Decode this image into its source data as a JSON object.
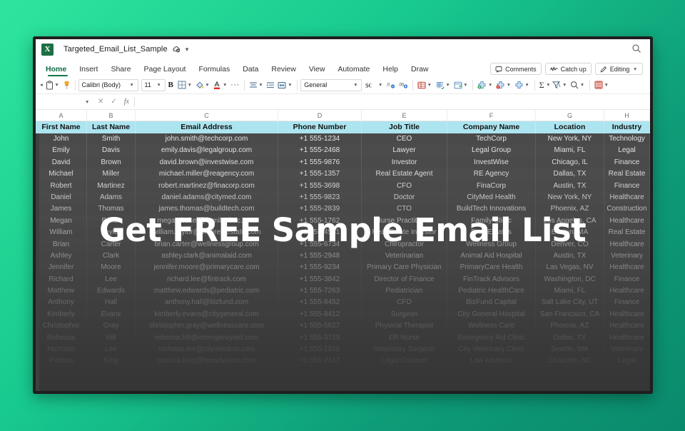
{
  "theme": {
    "background_gradient_from": "#2ee59d",
    "background_gradient_to": "#0a8a6c",
    "accent": "#11794c",
    "header_row_fill": "#ace4ef",
    "overlay_text_color": "#ffffff"
  },
  "overlay": {
    "headline": "Get FREE Sample Email List"
  },
  "titlebar": {
    "app_icon": "excel-icon",
    "app_icon_letter": "X",
    "document_name": "Targeted_Email_List_Sample",
    "cloud_status_icon": "cloud-saved-icon",
    "title_dropdown_icon": "chevron-down-icon",
    "search_icon": "search-icon"
  },
  "menu": {
    "tabs": [
      {
        "label": "Home",
        "active": true
      },
      {
        "label": "Insert",
        "active": false
      },
      {
        "label": "Share",
        "active": false
      },
      {
        "label": "Page Layout",
        "active": false
      },
      {
        "label": "Formulas",
        "active": false
      },
      {
        "label": "Data",
        "active": false
      },
      {
        "label": "Review",
        "active": false
      },
      {
        "label": "View",
        "active": false
      },
      {
        "label": "Automate",
        "active": false
      },
      {
        "label": "Help",
        "active": false
      },
      {
        "label": "Draw",
        "active": false
      }
    ],
    "right_buttons": [
      {
        "label": "Comments",
        "icon": "comment-bubble-icon"
      },
      {
        "label": "Catch up",
        "icon": "catch-up-icon"
      },
      {
        "label": "Editing",
        "icon": "pencil-icon",
        "dropdown": true
      }
    ]
  },
  "ribbon": {
    "font_name": "Calibri (Body)",
    "font_size": "11",
    "number_format": "General",
    "bold_label": "B",
    "overflow_label": "···",
    "autosum_label": "Σ",
    "items": [
      {
        "icon": "paste-icon"
      },
      {
        "icon": "format-painter-icon"
      },
      {
        "icon": "borders-icon"
      },
      {
        "icon": "fill-color-icon"
      },
      {
        "icon": "font-color-icon"
      },
      {
        "icon": "align-icon"
      },
      {
        "icon": "indent-icon"
      },
      {
        "icon": "merge-cells-icon"
      },
      {
        "icon": "currency-icon"
      },
      {
        "icon": "decrease-decimal-icon"
      },
      {
        "icon": "increase-decimal-icon"
      },
      {
        "icon": "conditional-formatting-icon"
      },
      {
        "icon": "format-as-table-icon"
      },
      {
        "icon": "cell-styles-icon"
      },
      {
        "icon": "insert-cells-icon"
      },
      {
        "icon": "delete-cells-icon"
      },
      {
        "icon": "format-cells-icon"
      },
      {
        "icon": "autosum-icon"
      },
      {
        "icon": "sort-filter-icon"
      },
      {
        "icon": "find-select-icon"
      },
      {
        "icon": "sensitivity-icon"
      }
    ]
  },
  "formula_bar": {
    "name_box_value": "",
    "cancel_icon": "cancel-x-icon",
    "confirm_icon": "confirm-check-icon",
    "function_icon": "fx-icon",
    "formula_value": ""
  },
  "sheet": {
    "column_letters": [
      "A",
      "B",
      "C",
      "D",
      "E",
      "F",
      "G",
      "H"
    ],
    "headers": [
      "First Name",
      "Last Name",
      "Email Address",
      "Phone Number",
      "Job Title",
      "Company Name",
      "Location",
      "Industry"
    ],
    "rows": [
      [
        "John",
        "Smith",
        "john.smith@techcorp.com",
        "+1 555-1234",
        "CEO",
        "TechCorp",
        "New York, NY",
        "Technology"
      ],
      [
        "Emily",
        "Davis",
        "emily.davis@legalgroup.com",
        "+1 555-2468",
        "Lawyer",
        "Legal Group",
        "Miami, FL",
        "Legal"
      ],
      [
        "David",
        "Brown",
        "david.brown@investwise.com",
        "+1 555-9876",
        "Investor",
        "InvestWise",
        "Chicago, IL",
        "Finance"
      ],
      [
        "Michael",
        "Miller",
        "michael.miller@reagency.com",
        "+1 555-1357",
        "Real Estate Agent",
        "RE Agency",
        "Dallas, TX",
        "Real Estate"
      ],
      [
        "Robert",
        "Martinez",
        "robert.martinez@finacorp.com",
        "+1 555-3698",
        "CFO",
        "FinaCorp",
        "Austin, TX",
        "Finance"
      ],
      [
        "Daniel",
        "Adams",
        "daniel.adams@citymed.com",
        "+1 555-9823",
        "Doctor",
        "CityMed Health",
        "New York, NY",
        "Healthcare"
      ],
      [
        "James",
        "Thomas",
        "james.thomas@buildtech.com",
        "+1 555-2839",
        "CTO",
        "BuildTech Innovations",
        "Phoenix, AZ",
        "Construction"
      ],
      [
        "Megan",
        "Baker",
        "megan.baker@familyclinic.com",
        "+1 555-1762",
        "Nurse Practitioner",
        "Family Clinic",
        "Los Angeles, CA",
        "Healthcare"
      ],
      [
        "William",
        "Taylor",
        "william.taylor@profirealestate.com",
        "+1 555-4581",
        "Real Estate Investor",
        "Profi Estates",
        "Boston, MA",
        "Real Estate"
      ],
      [
        "Brian",
        "Carter",
        "brian.carter@wellnessgroup.com",
        "+1 555-6734",
        "Chiropractor",
        "Wellness Group",
        "Denver, CO",
        "Healthcare"
      ],
      [
        "Ashley",
        "Clark",
        "ashley.clark@animalaid.com",
        "+1 555-2948",
        "Veterinarian",
        "Animal Aid Hospital",
        "Austin, TX",
        "Veterinary"
      ],
      [
        "Jennifer",
        "Moore",
        "jennifer.moore@primarycare.com",
        "+1 555-9234",
        "Primary Care Physician",
        "PrimaryCare Health",
        "Las Vegas, NV",
        "Healthcare"
      ],
      [
        "Richard",
        "Lee",
        "richard.lee@fintrack.com",
        "+1 555-3842",
        "Director of Finance",
        "FinTrack Advisors",
        "Washington, DC",
        "Finance"
      ],
      [
        "Matthew",
        "Edwards",
        "matthew.edwards@pediatric.com",
        "+1 555-7263",
        "Pediatrician",
        "Pediatric HealthCare",
        "Miami, FL",
        "Healthcare"
      ],
      [
        "Anthony",
        "Hall",
        "anthony.hall@bizfund.com",
        "+1 555-8452",
        "CFO",
        "BizFund Capital",
        "Salt Lake City, UT",
        "Finance"
      ],
      [
        "Kimberly",
        "Evans",
        "kimberly.evans@citygeneral.com",
        "+1 555-8412",
        "Surgeon",
        "City General Hospital",
        "San Francisco, CA",
        "Healthcare"
      ],
      [
        "Christopher",
        "Gray",
        "christopher.gray@wellnesscare.com",
        "+1 555-5627",
        "Physical Therapist",
        "Wellness Care",
        "Phoenix, AZ",
        "Healthcare"
      ],
      [
        "Rebecca",
        "Hill",
        "rebecca.hill@emergencyaid.com",
        "+1 555-3719",
        "ER Nurse",
        "Emergency Aid Clinic",
        "Dallas, TX",
        "Healthcare"
      ],
      [
        "Nicholas",
        "Lee",
        "nicholas.lee@cityvetclinic.com",
        "+1 555-1928",
        "Veterinary Surgeon",
        "City Veterinary Clinic",
        "Seattle, WA",
        "Veterinary"
      ],
      [
        "Patricia",
        "King",
        "patricia.king@lawadvisors.com",
        "+1 555-2147",
        "Legal Counsel",
        "Law Advisors",
        "Charlotte, NC",
        "Legal"
      ]
    ]
  }
}
